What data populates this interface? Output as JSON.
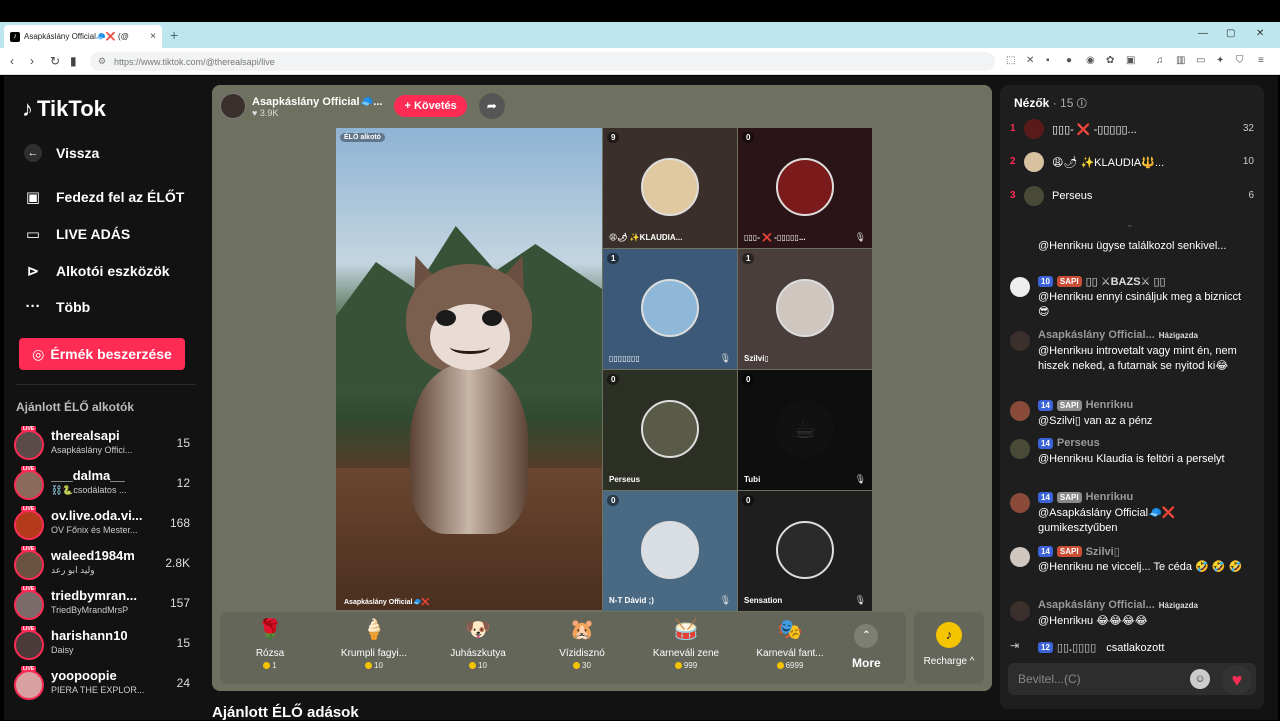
{
  "browser": {
    "tab_title": "Asapkáslány Official🧢❌ (@",
    "tab_close": "×",
    "new_tab": "+",
    "url": "https://www.tiktok.com/@therealsapi/live"
  },
  "sidebar": {
    "logo": "TikTok",
    "back": "Vissza",
    "menu": [
      {
        "label": "Fedezd fel az ÉLŐT",
        "icon": "tv-icon"
      },
      {
        "label": "LIVE ADÁS",
        "icon": "camera-icon"
      },
      {
        "label": "Alkotói eszközök",
        "icon": "play-icon"
      },
      {
        "label": "Több",
        "icon": "more-icon"
      }
    ],
    "coins_button": "Érmék beszerzése",
    "suggested_title": "Ajánlott ÉLŐ alkotók",
    "live_badge": "LIVE",
    "suggested": [
      {
        "name": "therealsapi",
        "sub": "Asapkáslány Offici...",
        "count": "15"
      },
      {
        "name": "___dalma__",
        "sub": "⛓️🐍csodálatos ...",
        "count": "12"
      },
      {
        "name": "ov.live.oda.vi...",
        "sub": "OV Főnix és Mester...",
        "count": "168"
      },
      {
        "name": "waleed1984m",
        "sub": "وليد ابو رعد",
        "count": "2.8K"
      },
      {
        "name": "triedbymran...",
        "sub": "TriedByMrandMrsP",
        "count": "157"
      },
      {
        "name": "harishann10",
        "sub": "Daisy",
        "count": "15"
      },
      {
        "name": "yoopoopie",
        "sub": "PIERA THE EXPLOR...",
        "count": "24"
      }
    ]
  },
  "host": {
    "name": "Asapkáslány Official🧢...",
    "likes": "♥ 3.9K",
    "follow": "+ Követés"
  },
  "stage": {
    "main_tag": "ÉLŐ alkotó",
    "main_name": "Asapkáslány Official🧢❌",
    "cells": [
      {
        "count": "9",
        "name": "😩🌶 ✨KLAUDIA..."
      },
      {
        "count": "0",
        "name": "▯▯▯- ❌ -▯▯▯▯▯..."
      },
      {
        "count": "1",
        "name": "▯▯▯▯▯▯▯"
      },
      {
        "count": "1",
        "name": "Szilvi▯"
      },
      {
        "count": "0",
        "name": "Perseus"
      },
      {
        "count": "0",
        "name": "Tubi"
      },
      {
        "count": "0",
        "name": "N-T Dávid ;)"
      },
      {
        "count": "0",
        "name": "Sensation"
      }
    ]
  },
  "gifts": [
    {
      "name": "Rózsa",
      "price": "1",
      "icon": "🌹"
    },
    {
      "name": "Krumpli fagyi...",
      "price": "10",
      "icon": "🍦"
    },
    {
      "name": "Juhászkutya",
      "price": "10",
      "icon": "🐶"
    },
    {
      "name": "Vízidisznó",
      "price": "30",
      "icon": "🐹"
    },
    {
      "name": "Karneváli zene",
      "price": "999",
      "icon": "🥁"
    },
    {
      "name": "Karnevál fant...",
      "price": "6999",
      "icon": "🎭"
    }
  ],
  "gift_more": "More",
  "recharge": "Recharge ^",
  "below_title": "Ajánlott ÉLŐ adások",
  "chat": {
    "viewers_label": "Nézők",
    "viewers_count": "· 15",
    "ranking": [
      {
        "rank": "1",
        "name": "▯▯▯- ❌ -▯▯▯▯▯...",
        "score": "32"
      },
      {
        "rank": "2",
        "name": "😩🌶 ✨KLAUDIA🔱...",
        "score": "10"
      },
      {
        "rank": "3",
        "name": "Perseus",
        "score": "6"
      }
    ],
    "messages": [
      {
        "badges": [],
        "user": "",
        "text": "@Henrikнu ügyse találkozol senkivel..."
      },
      {
        "badges": [
          "10",
          "SAPI"
        ],
        "user": "▯▯ ⚔BAZS⚔ ▯▯",
        "text": "@Henrikнu ennyi csináljuk meg a biznicct😎"
      },
      {
        "badges": [],
        "user": "Asapkáslány Official...",
        "host": "Házigazda",
        "text": "@Henrikнu introvetalt vagy mint én, nem hiszek neked, a futarnak se nyitod ki😂"
      },
      {
        "badges": [
          "14",
          "SAPI"
        ],
        "user": "Henrikнu",
        "text": "@Szilvi▯ van az a pénz"
      },
      {
        "badges": [
          "14"
        ],
        "user": "Perseus",
        "text": "@Henrikнu Klaudia is feltöri a perselyt"
      },
      {
        "badges": [
          "14",
          "SAPI"
        ],
        "user": "Henrikнu",
        "text": "@Asapkáslány Official🧢❌ gumikesztyűben"
      },
      {
        "badges": [
          "14",
          "SAPI"
        ],
        "user": "Szilvi▯",
        "text": "@Henrikнu ne viccelj... Te céda 🤣 🤣 🤣"
      },
      {
        "badges": [],
        "user": "Asapkáslány Official...",
        "host": "Házigazda",
        "text": "@Henrikнu 😂😂😂😂"
      },
      {
        "badges": [
          "12"
        ],
        "user": "▯▯.▯▯▯▯",
        "text": "csatlakozott"
      }
    ],
    "input_placeholder": "Bevitel...(C)"
  }
}
